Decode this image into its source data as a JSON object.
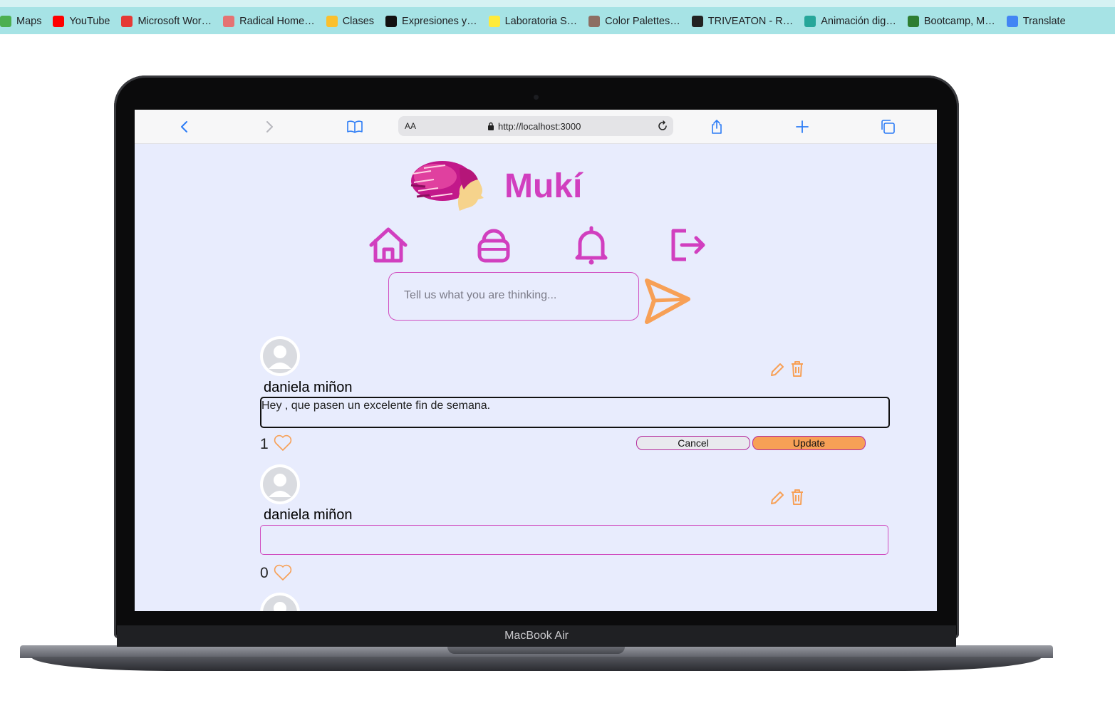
{
  "bookmarks": [
    {
      "label": "Maps",
      "color": "#4caf50"
    },
    {
      "label": "YouTube",
      "color": "#ff0000"
    },
    {
      "label": "Microsoft Wor…",
      "color": "#e53935"
    },
    {
      "label": "Radical Home…",
      "color": "#e57373"
    },
    {
      "label": "Clases",
      "color": "#fbc02d"
    },
    {
      "label": "Expresiones y…",
      "color": "#111111"
    },
    {
      "label": "Laboratoria S…",
      "color": "#ffeb3b"
    },
    {
      "label": "Color Palettes…",
      "color": "#8d6e63"
    },
    {
      "label": "TRIVEATON - R…",
      "color": "#222222"
    },
    {
      "label": "Animación dig…",
      "color": "#26a69a"
    },
    {
      "label": "Bootcamp, M…",
      "color": "#2e7d32"
    },
    {
      "label": "Translate",
      "color": "#4285f4"
    }
  ],
  "laptop": {
    "label": "MacBook Air"
  },
  "safari": {
    "aa": "AA",
    "url": "http://localhost:3000",
    "icons": [
      "back-icon",
      "forward-icon",
      "bookmarks-icon",
      "reload-icon",
      "share-icon",
      "new-tab-icon",
      "tabs-icon"
    ]
  },
  "app": {
    "title": "Mukí",
    "brand_color": "#d13fbf",
    "accent_color": "#f7a056",
    "nav": [
      "home-icon",
      "lock-icon",
      "bell-icon",
      "logout-icon"
    ]
  },
  "composer": {
    "placeholder": "Tell us what you are thinking..."
  },
  "posts": [
    {
      "author": "daniela miñon",
      "text": "Hey , que pasen un excelente fin de semana.",
      "likes": "1",
      "editing": true
    },
    {
      "author": "daniela miñon",
      "text": "",
      "likes": "0",
      "editing": false
    }
  ],
  "edit_buttons": {
    "cancel": "Cancel",
    "update": "Update"
  }
}
